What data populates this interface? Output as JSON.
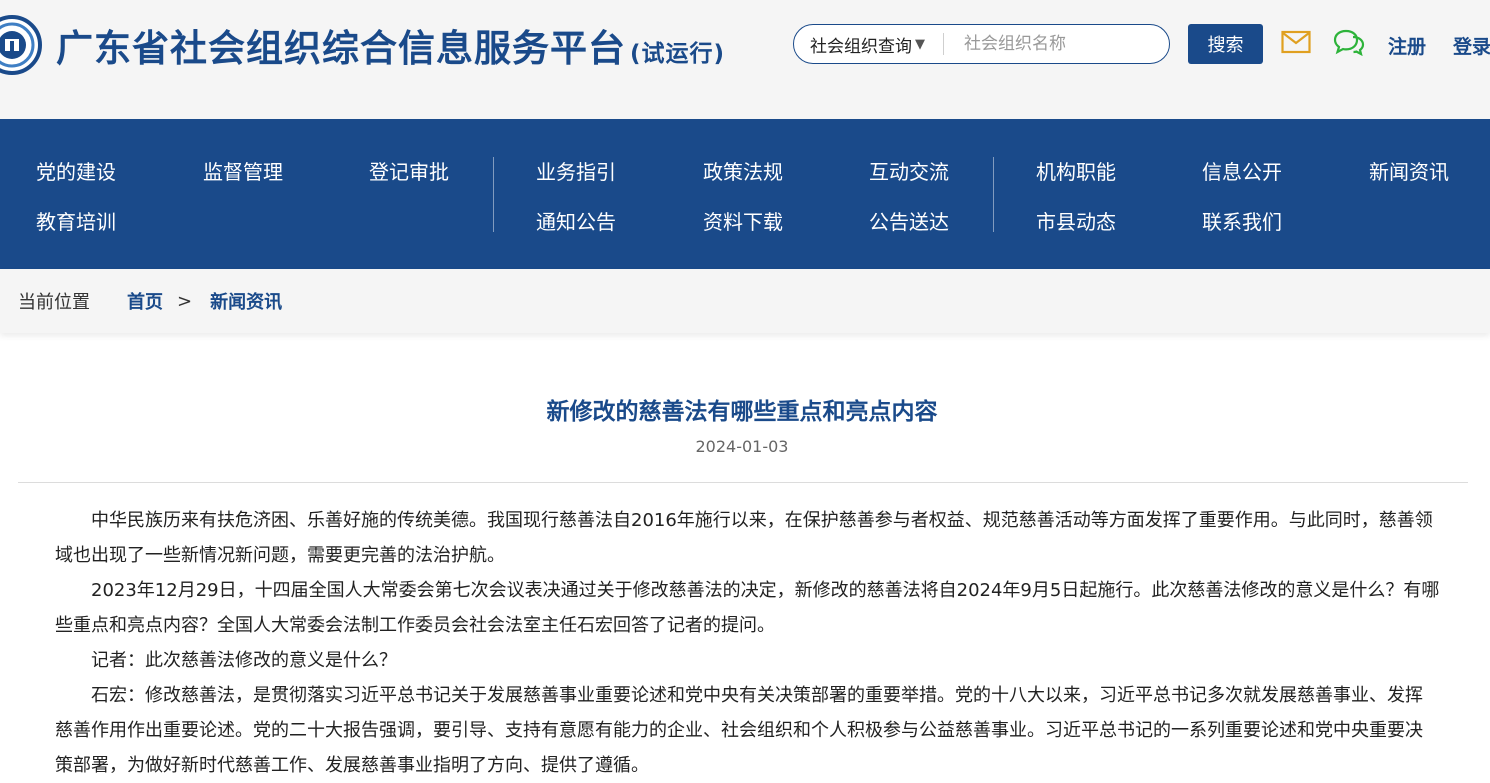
{
  "header": {
    "title": "广东省社会组织综合信息服务平台",
    "title_suffix": "(试运行)",
    "search": {
      "select_value": "社会组织查询",
      "placeholder": "社会组织名称",
      "button_label": "搜索"
    },
    "register_label": "注册",
    "login_label": "登录",
    "icons": [
      "mail-icon",
      "chat-icon"
    ]
  },
  "nav": {
    "items": [
      "党的建设",
      "监督管理",
      "登记审批",
      "业务指引",
      "政策法规",
      "互动交流",
      "机构职能",
      "信息公开",
      "新闻资讯",
      "教育培训",
      "通知公告",
      "资料下载",
      "公告送达",
      "市县动态",
      "联系我们"
    ]
  },
  "breadcrumb": {
    "label": "当前位置",
    "home": "首页",
    "separator": ">",
    "current": "新闻资讯"
  },
  "article": {
    "title": "新修改的慈善法有哪些重点和亮点内容",
    "date": "2024-01-03",
    "paragraphs": [
      "中华民族历来有扶危济困、乐善好施的传统美德。我国现行慈善法自2016年施行以来，在保护慈善参与者权益、规范慈善活动等方面发挥了重要作用。与此同时，慈善领域也出现了一些新情况新问题，需要更完善的法治护航。",
      "2023年12月29日，十四届全国人大常委会第七次会议表决通过关于修改慈善法的决定，新修改的慈善法将自2024年9月5日起施行。此次慈善法修改的意义是什么？有哪些重点和亮点内容？全国人大常委会法制工作委员会社会法室主任石宏回答了记者的提问。",
      "记者：此次慈善法修改的意义是什么？",
      "石宏：修改慈善法，是贯彻落实习近平总书记关于发展慈善事业重要论述和党中央有关决策部署的重要举措。党的十八大以来，习近平总书记多次就发展慈善事业、发挥慈善作用作出重要论述。党的二十大报告强调，要引导、支持有意愿有能力的企业、社会组织和个人积极参与公益慈善事业。习近平总书记的一系列重要论述和党中央重要决策部署，为做好新时代慈善工作、发展慈善事业指明了方向、提供了遵循。"
    ]
  },
  "colors": {
    "brand_blue": "#1a4a8a",
    "header_bg": "#f5f5f5",
    "mail_icon": "#e0a020",
    "chat_icon": "#2db33a"
  }
}
